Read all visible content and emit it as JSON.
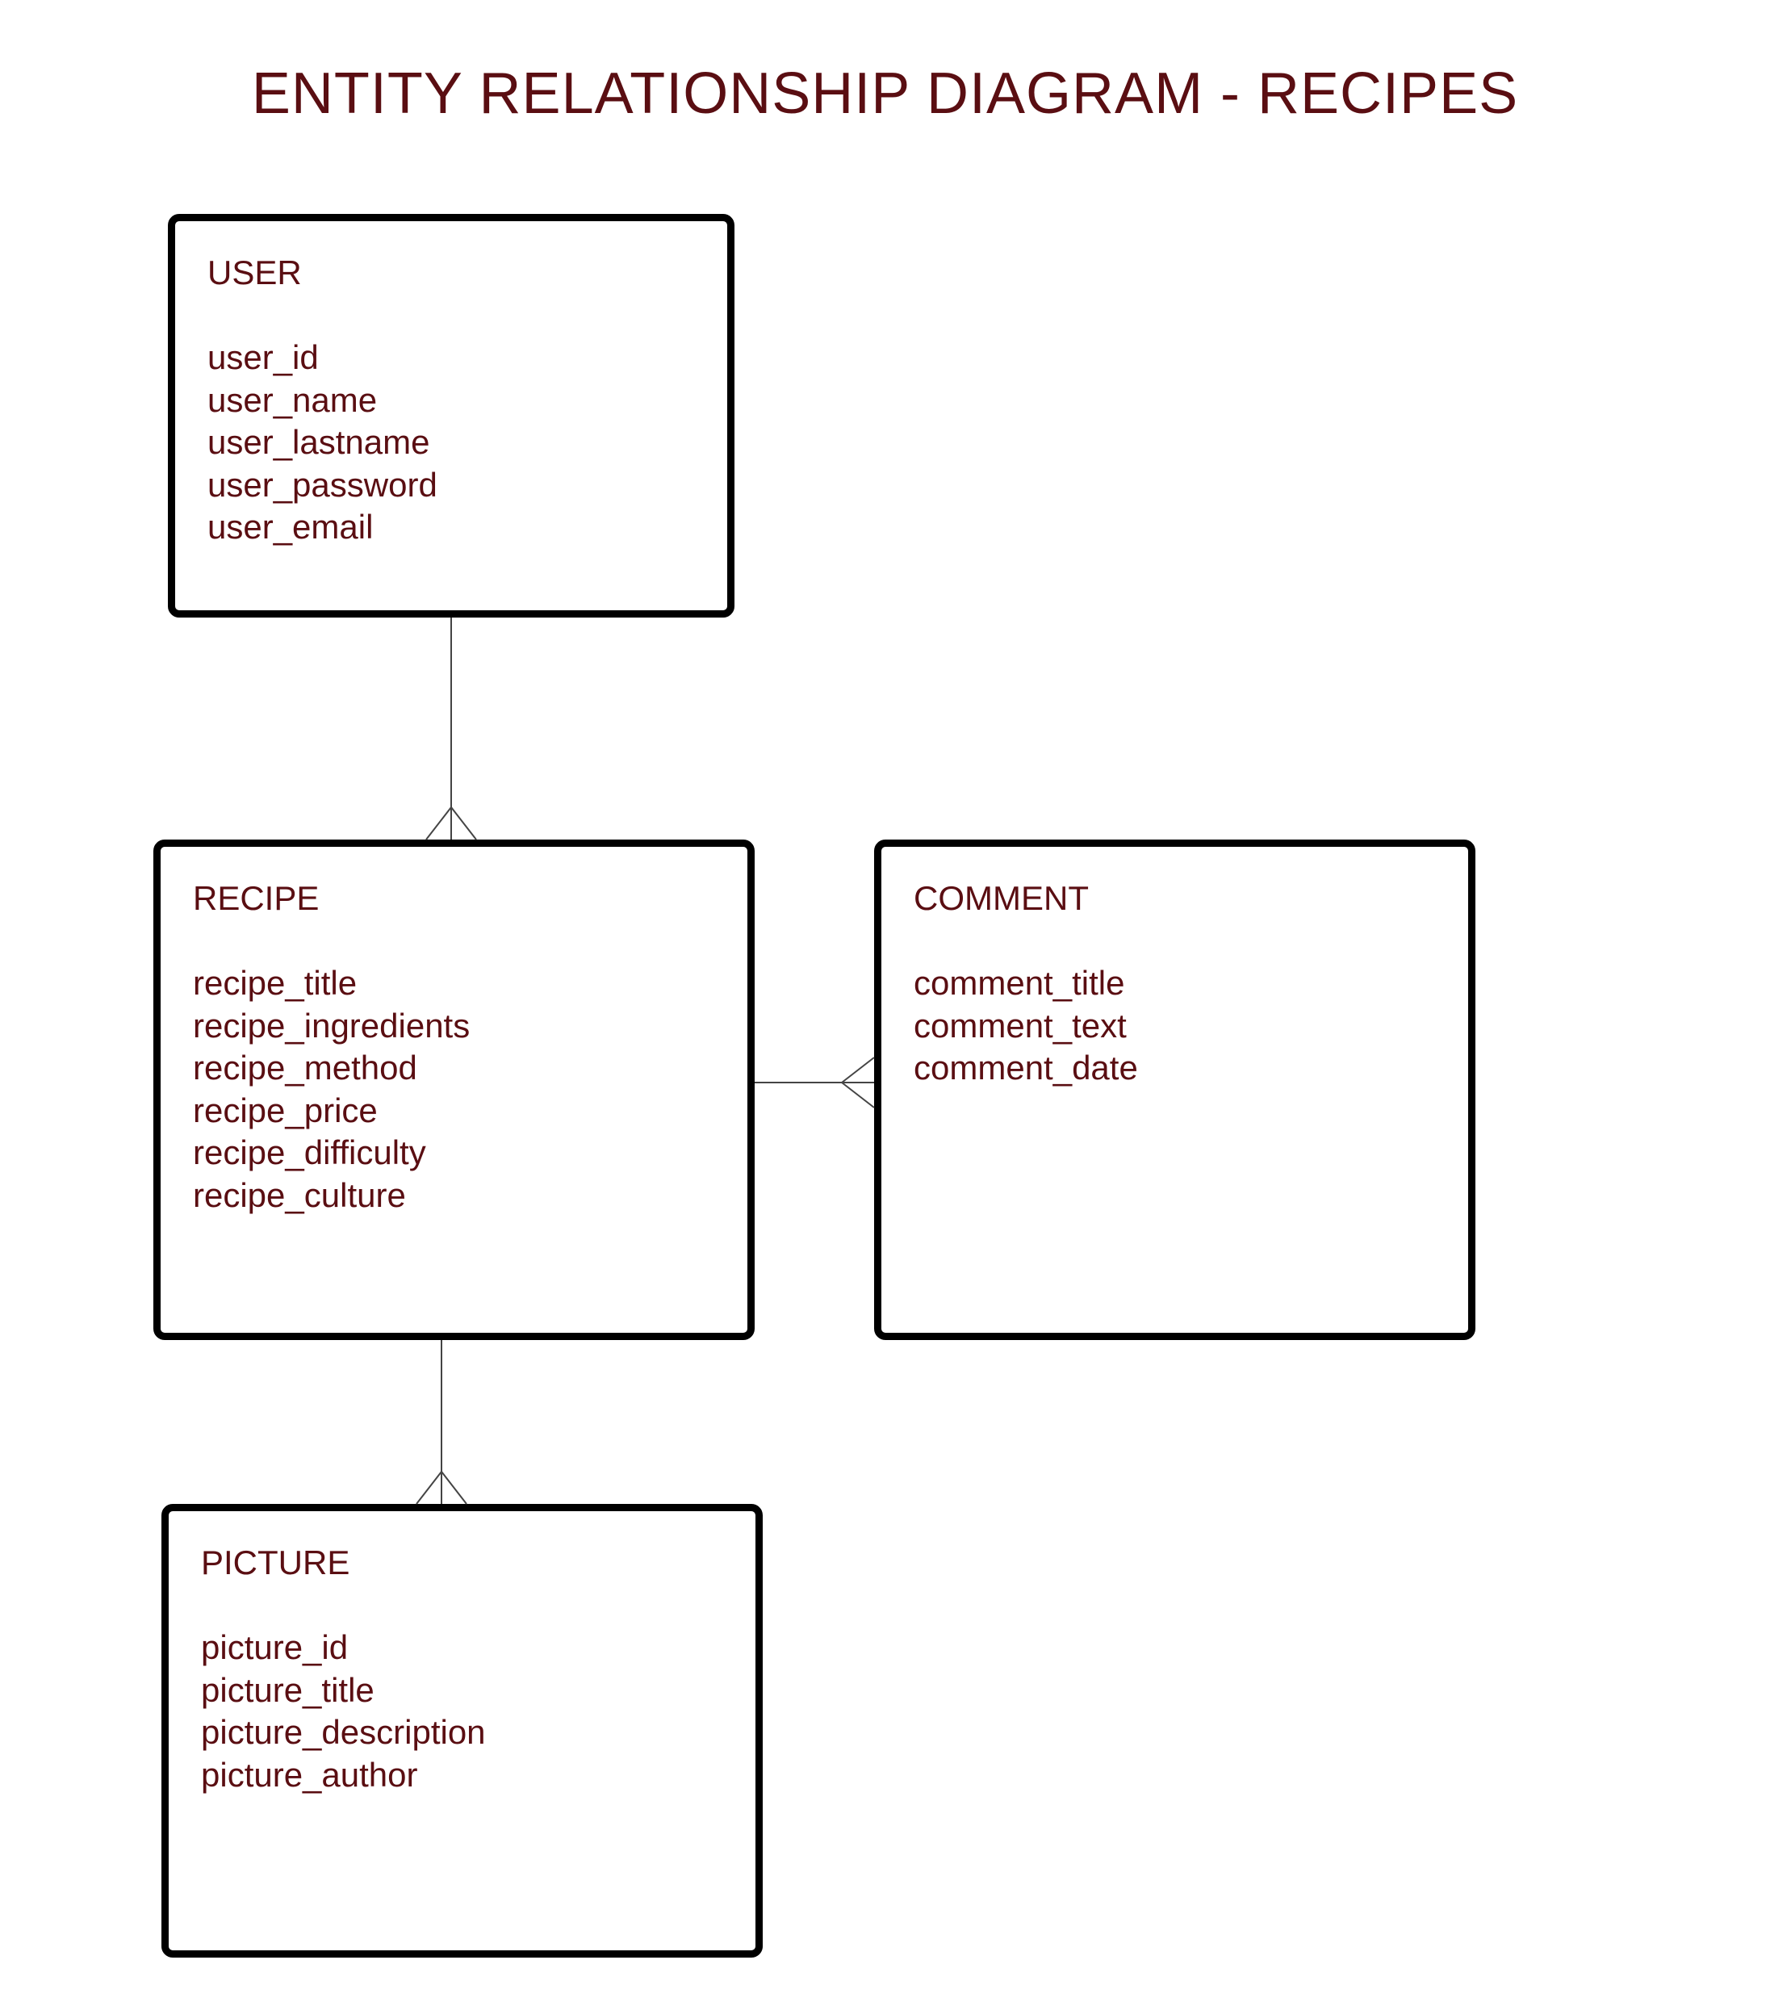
{
  "title": "ENTITY RELATIONSHIP DIAGRAM - RECIPES",
  "entities": {
    "user": {
      "name": "USER",
      "fields": [
        "user_id",
        "user_name",
        "user_lastname",
        "user_password",
        "user_email"
      ]
    },
    "recipe": {
      "name": "RECIPE",
      "fields": [
        "recipe_title",
        "recipe_ingredients",
        "recipe_method",
        "recipe_price",
        "recipe_difficulty",
        "recipe_culture"
      ]
    },
    "comment": {
      "name": "COMMENT",
      "fields": [
        "comment_title",
        "comment_text",
        "comment_date"
      ]
    },
    "picture": {
      "name": "PICTURE",
      "fields": [
        "picture_id",
        "picture_title",
        "picture_description",
        "picture_author"
      ]
    }
  }
}
